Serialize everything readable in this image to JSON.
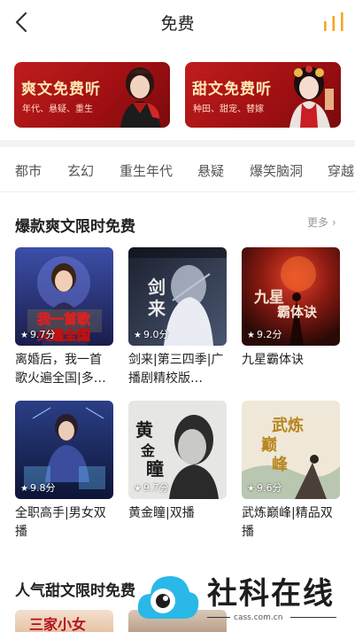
{
  "header": {
    "title": "免费",
    "back_icon": "chevron-left-icon",
    "rank_icon": "bar-chart-icon",
    "accent": "#f5a623"
  },
  "banners": [
    {
      "title": "爽文免费听",
      "subtitle": "年代、悬疑、重生"
    },
    {
      "title": "甜文免费听",
      "subtitle": "种田、甜宠、替嫁"
    }
  ],
  "tabs": [
    "都市",
    "玄幻",
    "重生年代",
    "悬疑",
    "爆笑脑洞",
    "穿越"
  ],
  "section1": {
    "title": "爆款爽文限时免费",
    "more": "更多",
    "books": [
      {
        "title": "离婚后，我一首歌火遍全国|多…",
        "rating": "9.7分",
        "cover_text": "我一首歌 火遍全国"
      },
      {
        "title": "剑来|第三四季|广播剧精校版…",
        "rating": "9.0分",
        "cover_text": "剑来"
      },
      {
        "title": "九星霸体诀",
        "rating": "9.2分",
        "cover_text": "九星霸体诀"
      },
      {
        "title": "全职高手|男女双播",
        "rating": "9.8分",
        "cover_text": ""
      },
      {
        "title": "黄金瞳|双播",
        "rating": "9.7分",
        "cover_text": "黄金瞳"
      },
      {
        "title": "武炼巅峰|精品双播",
        "rating": "9.6分",
        "cover_text": "武炼巅峰"
      }
    ]
  },
  "section2": {
    "title": "人气甜文限时免费"
  },
  "watermark": {
    "text": "社科在线",
    "url": "cass.com.cn"
  }
}
